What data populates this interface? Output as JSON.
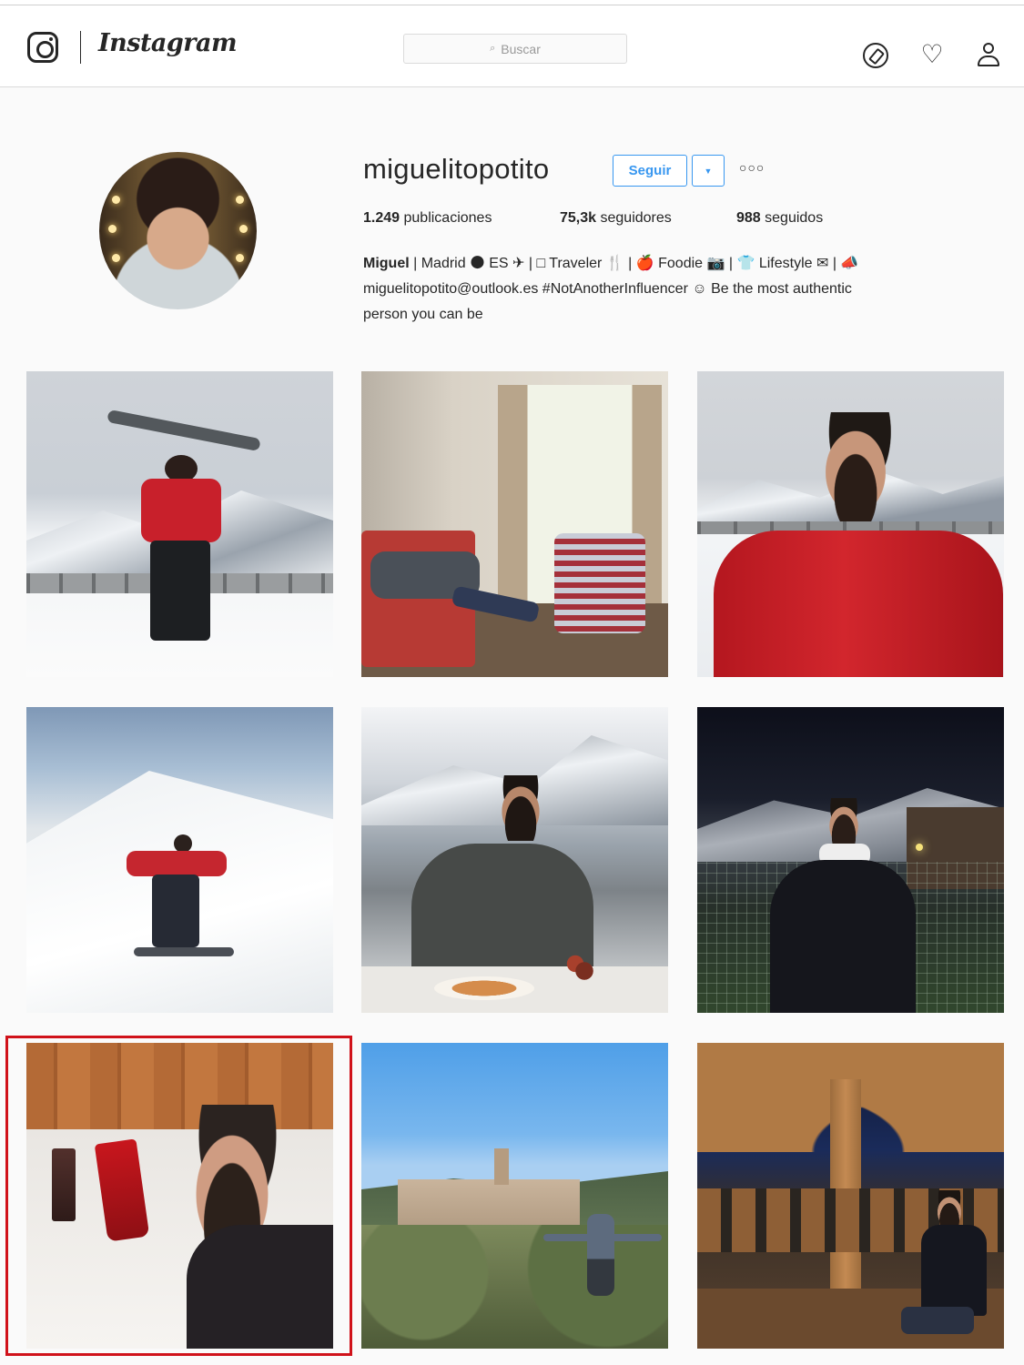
{
  "navbar": {
    "wordmark": "Instagram",
    "search_placeholder": "Buscar",
    "icons": [
      "instagram-camera-icon",
      "explore-compass-icon",
      "activity-heart-icon",
      "profile-person-icon"
    ]
  },
  "profile": {
    "username": "miguelitopotito",
    "follow_label": "Seguir",
    "stats": {
      "posts_value": "1.249",
      "posts_label": "publicaciones",
      "followers_value": "75,3k",
      "followers_label": "seguidores",
      "following_value": "988",
      "following_label": "seguidos"
    },
    "bio": {
      "name": "Miguel",
      "line1": "| Madrid 🌑 ES ✈ | □ Traveler 🍴 | 🍎 Foodie 📷 | 👕 Lifestyle ✉ | 📣",
      "line2": "miguelitopotito@outlook.es #NotAnotherInfluencer ☺ Be the most authentic",
      "line3": "person you can be"
    }
  },
  "grid": {
    "posts": [
      "snowboard-overhead-post",
      "hotel-room-laptop-post",
      "red-jacket-mountains-post",
      "snowboarding-slope-post",
      "breakfast-table-post",
      "night-village-post",
      "skincare-products-bed-post",
      "town-panorama-post",
      "cloister-arches-post"
    ],
    "highlighted_post_index": 6
  },
  "colors": {
    "accent_blue": "#3897f0",
    "highlight_red": "#d0121a",
    "text_dark": "#262626"
  }
}
